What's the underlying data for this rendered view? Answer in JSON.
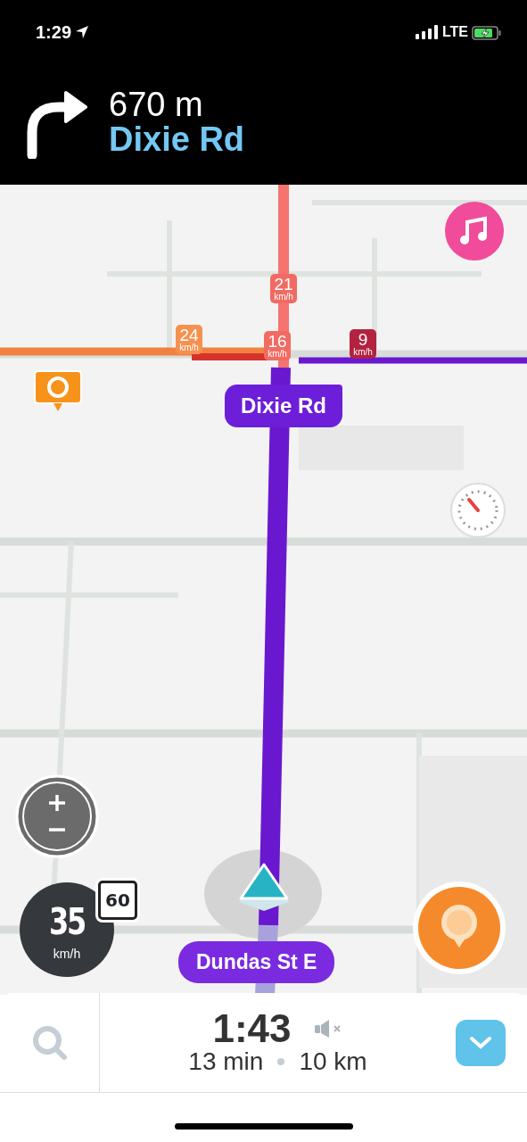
{
  "status_bar": {
    "time": "1:29",
    "network": "LTE",
    "charging": true
  },
  "instruction": {
    "distance": "670 m",
    "street": "Dixie Rd"
  },
  "map": {
    "speed_tags": [
      {
        "speed": "21",
        "unit": "km/h",
        "color": "#f26b63"
      },
      {
        "speed": "24",
        "unit": "km/h",
        "color": "#f5914f"
      },
      {
        "speed": "16",
        "unit": "km/h",
        "color": "#f26b63"
      },
      {
        "speed": "9",
        "unit": "km/h",
        "color": "#b3223f"
      }
    ],
    "turn_label": "Dixie Rd",
    "current_street": "Dundas St E"
  },
  "speedometer": {
    "speed": "35",
    "unit": "km/h",
    "limit": "60"
  },
  "eta": {
    "arrival": "1:43",
    "duration": "13 min",
    "distance": "10 km",
    "muted": true
  }
}
